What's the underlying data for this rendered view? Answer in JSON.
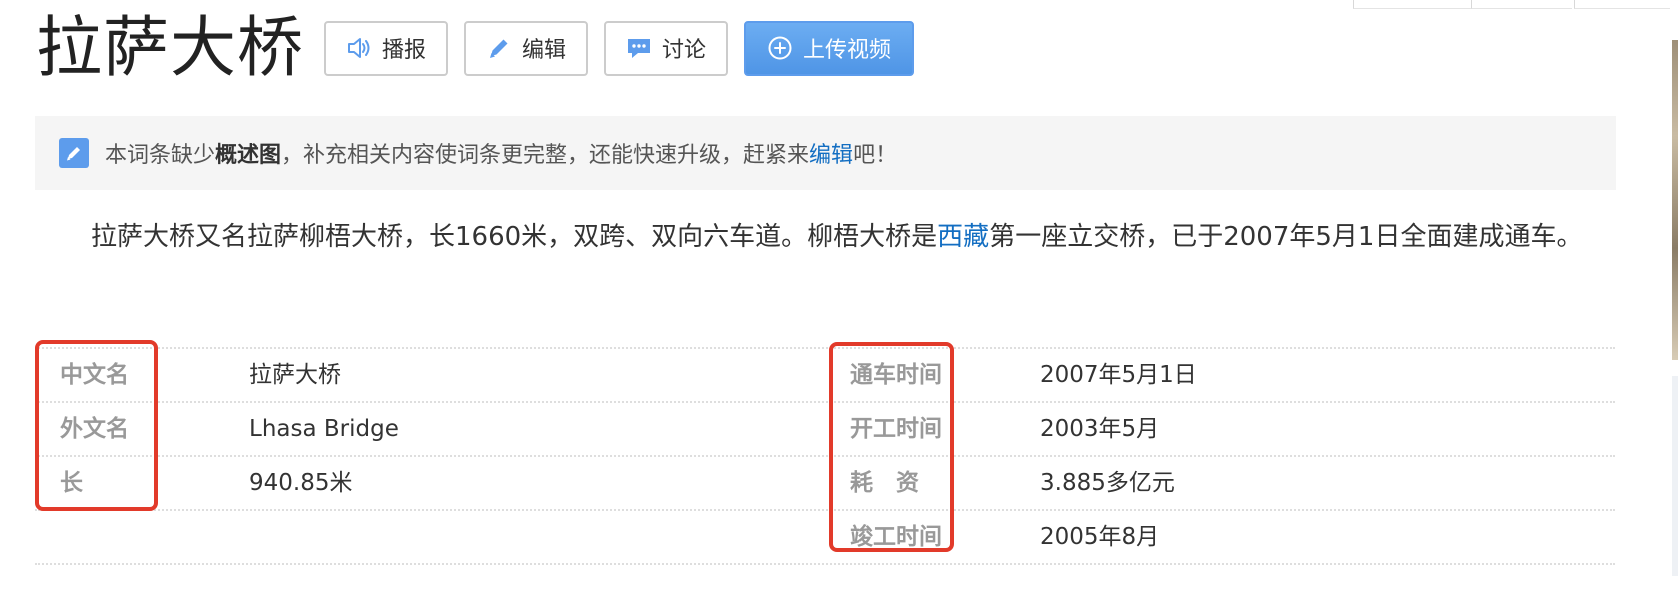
{
  "header": {
    "title": "拉萨大桥",
    "buttons": {
      "broadcast": "播报",
      "edit": "编辑",
      "discuss": "讨论",
      "upload_video": "上传视频"
    }
  },
  "notice": {
    "prefix": "本词条缺少",
    "bold": "概述图",
    "middle": "，补充相关内容使词条更完整，还能快速升级，赶紧来",
    "link": "编辑",
    "suffix": "吧！",
    "icon": "pencil-icon"
  },
  "summary": {
    "part1": "拉萨大桥又名拉萨柳梧大桥，长1660米，双跨、双向六车道。柳梧大桥是",
    "link": "西藏",
    "part2": "第一座立交桥，已于2007年5月1日全面建成通车。"
  },
  "info": {
    "left": [
      {
        "name": "中文名",
        "value": "拉萨大桥"
      },
      {
        "name": "外文名",
        "value": "Lhasa Bridge"
      },
      {
        "name": "长",
        "value": "940.85米"
      }
    ],
    "right": [
      {
        "name": "通车时间",
        "value": "2007年5月1日"
      },
      {
        "name": "开工时间",
        "value": "2003年5月"
      },
      {
        "name": "耗　资",
        "value": "3.885多亿元"
      },
      {
        "name": "竣工时间",
        "value": "2005年8月"
      }
    ]
  },
  "colors": {
    "link": "#136ec2",
    "accent": "#5d9cec",
    "highlight": "#e23a2a"
  }
}
